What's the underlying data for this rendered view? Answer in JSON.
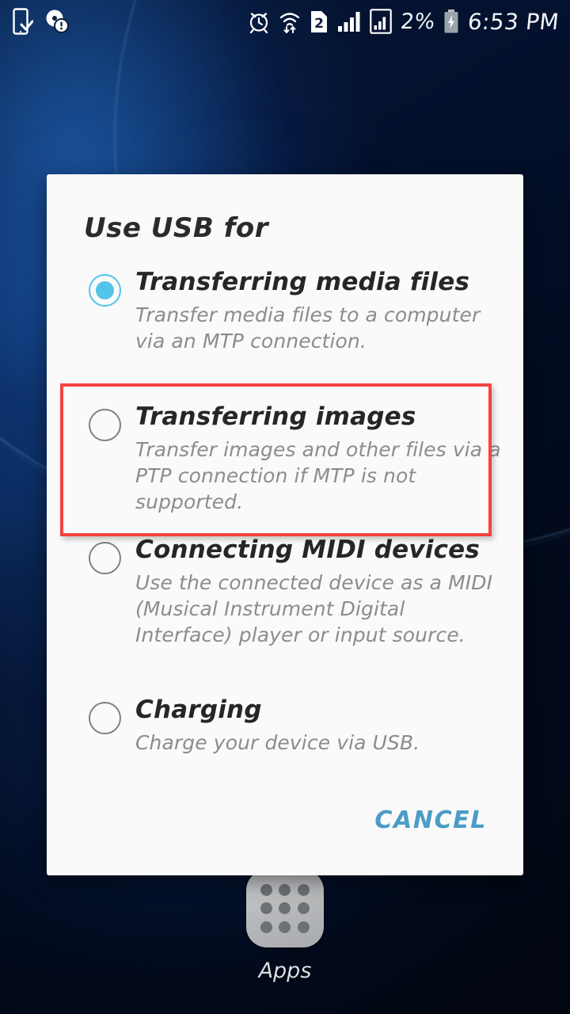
{
  "statusbar": {
    "left_icons": [
      {
        "name": "phone-download-check-icon",
        "glyph": "device-check"
      },
      {
        "name": "disc-warning-icon",
        "glyph": "disc-alert"
      }
    ],
    "right_icons": [
      {
        "name": "alarm-clock-icon",
        "glyph": "alarm"
      },
      {
        "name": "wifi-transfer-icon",
        "glyph": "wifi-arrows"
      },
      {
        "name": "sim-card-2-icon",
        "glyph": "sim2",
        "label": "2"
      },
      {
        "name": "signal-bars-icon",
        "glyph": "signal"
      },
      {
        "name": "signal-boxed-icon",
        "glyph": "signal-box"
      }
    ],
    "battery_percent": "2%",
    "battery_charging": true,
    "clock": "6:53 PM"
  },
  "dialog": {
    "title": "Use USB for",
    "options": [
      {
        "id": "transferring-media-files",
        "title": "Transferring media files",
        "description": "Transfer media files to a computer via an MTP connection.",
        "selected": true,
        "highlighted": false
      },
      {
        "id": "transferring-images",
        "title": "Transferring images",
        "description": "Transfer images and other files via a PTP connection if MTP is not supported.",
        "selected": false,
        "highlighted": true
      },
      {
        "id": "connecting-midi-devices",
        "title": "Connecting MIDI devices",
        "description": "Use the connected device as a MIDI (Musical Instrument Digital Interface) player or input source.",
        "selected": false,
        "highlighted": false
      },
      {
        "id": "charging",
        "title": "Charging",
        "description": "Charge your device via USB.",
        "selected": false,
        "highlighted": false
      }
    ],
    "cancel_label": "CANCEL"
  },
  "home": {
    "apps_label": "Apps"
  },
  "colors": {
    "accent_radio": "#52c3e9",
    "cancel_text": "#4b9cc6",
    "highlight_border": "#f4433f",
    "dialog_bg": "#fafafa",
    "title_text": "#2b2b2b",
    "desc_text": "#8c8c8c"
  }
}
